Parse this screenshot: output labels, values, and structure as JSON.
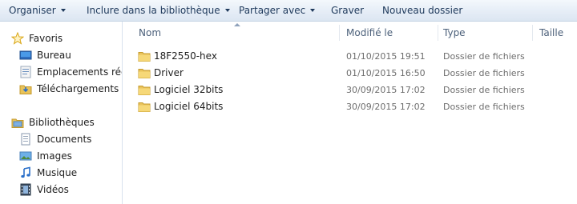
{
  "toolbar": {
    "organize": "Organiser",
    "include_library": "Inclure dans la bibliothèque",
    "share_with": "Partager avec",
    "burn": "Graver",
    "new_folder": "Nouveau dossier"
  },
  "nav": {
    "favorites": "Favoris",
    "desktop": "Bureau",
    "recent_places": "Emplacements récents",
    "downloads": "Téléchargements",
    "libraries": "Bibliothèques",
    "documents": "Documents",
    "pictures": "Images",
    "music": "Musique",
    "videos": "Vidéos"
  },
  "columns": {
    "name": "Nom",
    "modified": "Modifié le",
    "type": "Type",
    "size": "Taille"
  },
  "files": [
    {
      "name": "18F2550-hex",
      "modified": "01/10/2015 19:51",
      "type": "Dossier de fichiers"
    },
    {
      "name": "Driver",
      "modified": "01/10/2015 16:50",
      "type": "Dossier de fichiers"
    },
    {
      "name": "Logiciel 32bits",
      "modified": "30/09/2015 17:02",
      "type": "Dossier de fichiers"
    },
    {
      "name": "Logiciel 64bits",
      "modified": "30/09/2015 17:02",
      "type": "Dossier de fichiers"
    }
  ]
}
